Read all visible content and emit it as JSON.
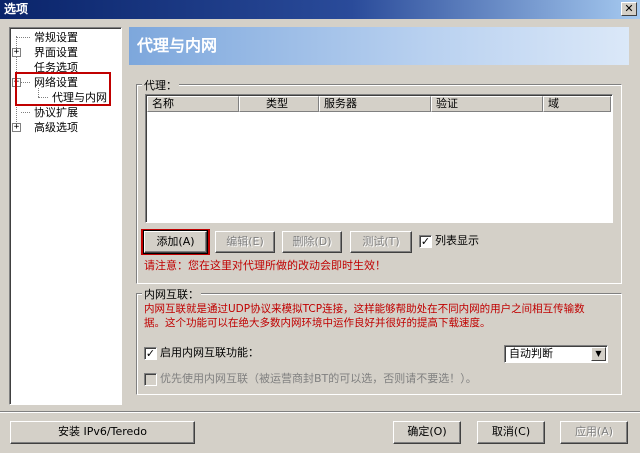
{
  "window": {
    "title": "选项",
    "close_glyph": "✕"
  },
  "sidebar": {
    "items": [
      {
        "label": "常规设置"
      },
      {
        "label": "界面设置",
        "expander": "+"
      },
      {
        "label": "任务选项"
      },
      {
        "label": "网络设置",
        "expander": "−"
      },
      {
        "label": "代理与内网"
      },
      {
        "label": "协议扩展"
      },
      {
        "label": "高级选项",
        "expander": "+"
      }
    ]
  },
  "header": {
    "title": "代理与内网"
  },
  "proxy": {
    "group_label": "代理：",
    "columns": [
      "名称",
      "类型",
      "服务器",
      "验证",
      "域"
    ],
    "rows": [],
    "buttons": {
      "add": "添加(A)",
      "edit": "编辑(E)",
      "delete": "删除(D)",
      "test": "测试(T)"
    },
    "list_display_label": "列表显示",
    "list_display_checked": true,
    "check_glyph": "✓",
    "notice": "请注意：您在这里对代理所做的改动会即时生效！"
  },
  "intranet": {
    "group_label": "内网互联：",
    "description_line1": "内网互联就是通过UDP协议来模拟TCP连接，这样能够帮助处在不同内网的用户之间相互传输数",
    "description_line2": "据。这个功能可以在绝大多数内网环境中运作良好并很好的提高下载速度。",
    "enable_label": "启用内网互联功能：",
    "enable_checked": true,
    "mode_select": "自动判断",
    "mode_arrow": "▼",
    "prefer_label": "优先使用内网互联（被运营商封BT的可以选，否则请不要选！）。",
    "prefer_checked": false
  },
  "footer": {
    "install_button": "安装 IPv6/Teredo",
    "ok_button": "确定(O)",
    "cancel_button": "取消(C)",
    "apply_button": "应用(A)"
  },
  "colors": {
    "accent_red": "#c00000",
    "header_blue": "#7da7dc",
    "title_bar": "#0a246a"
  }
}
